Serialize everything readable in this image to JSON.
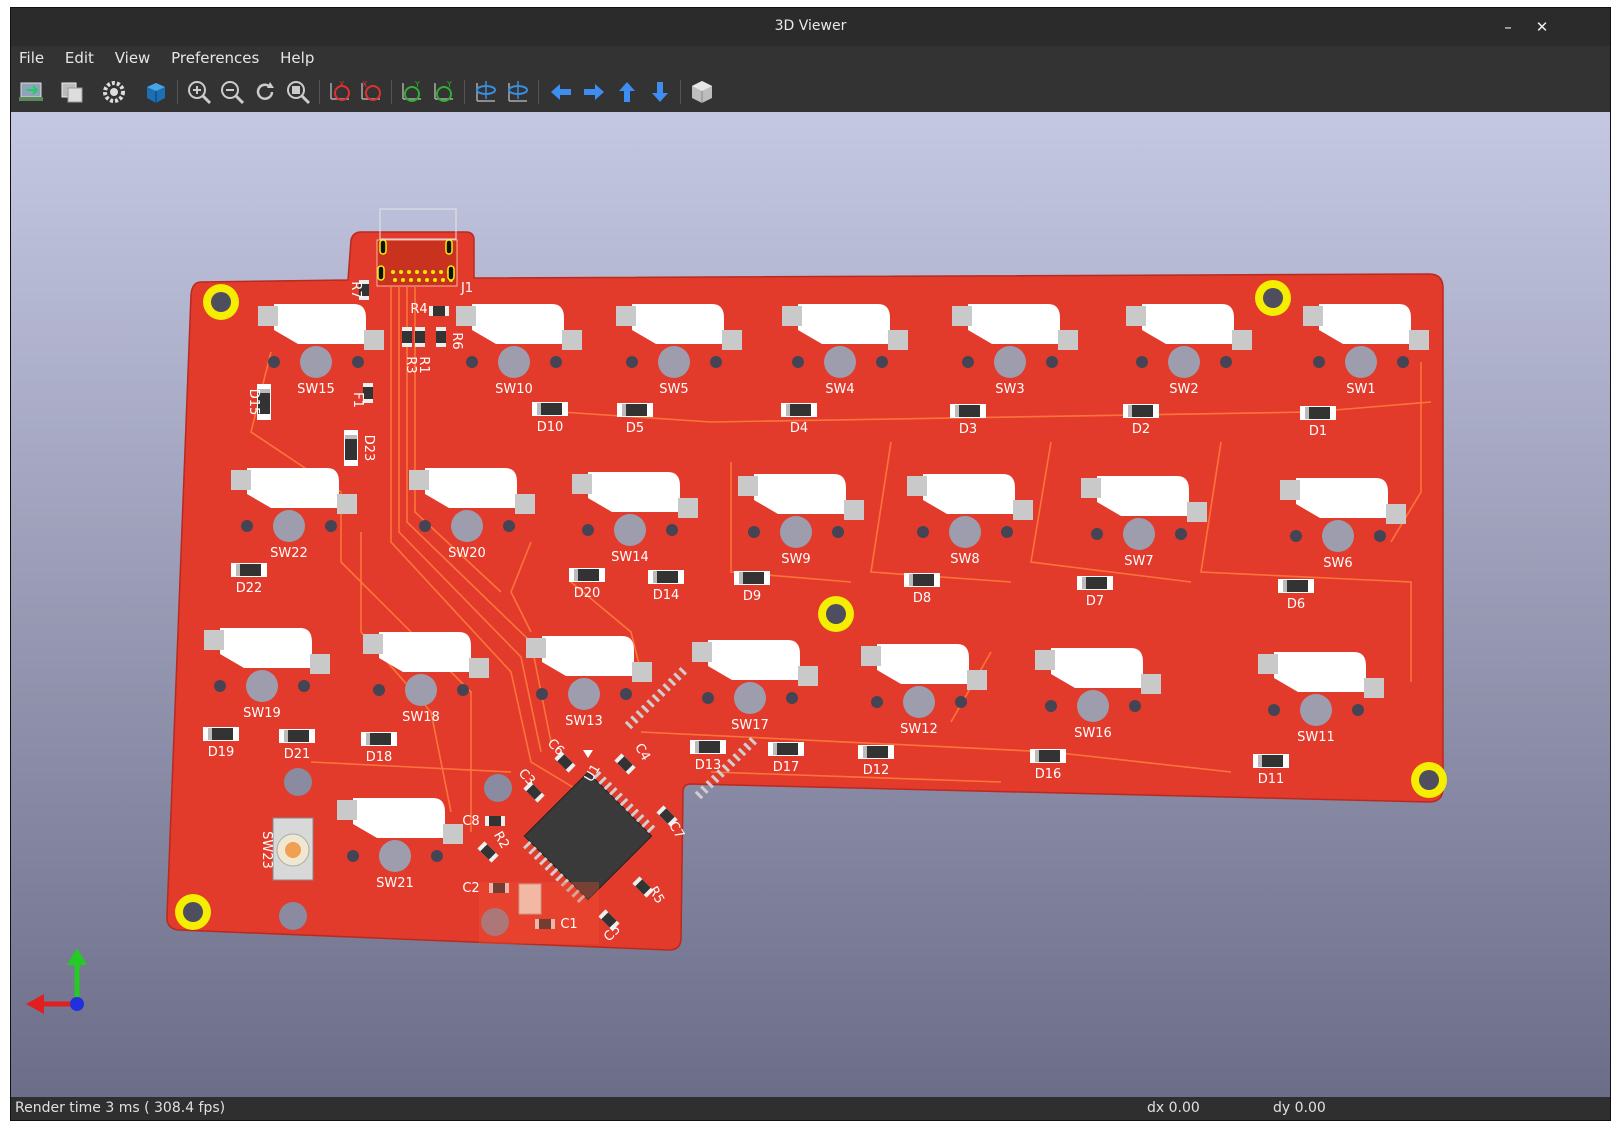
{
  "window": {
    "title": "3D Viewer",
    "minimize_glyph": "–",
    "close_glyph": "✕"
  },
  "menu": [
    "File",
    "Edit",
    "View",
    "Preferences",
    "Help"
  ],
  "toolbar": [
    {
      "icon": "reload-board-icon"
    },
    {
      "icon": "copy-image-icon"
    },
    {
      "icon": "settings-gear-icon"
    },
    {
      "icon": "raytracing-cube-icon"
    },
    {
      "icon": "zoom-in-icon"
    },
    {
      "icon": "zoom-out-icon"
    },
    {
      "icon": "redraw-icon"
    },
    {
      "icon": "zoom-fit-icon"
    },
    {
      "icon": "rotate-x-cw-icon"
    },
    {
      "icon": "rotate-x-ccw-icon"
    },
    {
      "icon": "rotate-y-cw-icon"
    },
    {
      "icon": "rotate-y-ccw-icon"
    },
    {
      "icon": "rotate-z-cw-icon"
    },
    {
      "icon": "rotate-z-ccw-icon"
    },
    {
      "icon": "pan-left-icon"
    },
    {
      "icon": "pan-right-icon"
    },
    {
      "icon": "pan-up-icon"
    },
    {
      "icon": "pan-down-icon"
    },
    {
      "icon": "orthographic-toggle-icon"
    }
  ],
  "status": {
    "render": "Render time 3 ms ( 308.4 fps)",
    "dx": "dx 0.00",
    "dy": "dy 0.00"
  },
  "colors": {
    "background_top": "#c5c8e2",
    "background_bottom": "#6c6d88",
    "board": "#e23b2c",
    "trace": "#ff7b3c",
    "mounting_hole": "#f5ee00",
    "keycap": "#ffffff",
    "pad": "#c9c9c9"
  },
  "board": {
    "connector": "J1",
    "resistors": [
      "R7",
      "R4",
      "R1",
      "R3",
      "R6",
      "R2",
      "R5"
    ],
    "fuse": "F1",
    "capacitors": [
      "C6",
      "C3",
      "C4",
      "C8",
      "C7",
      "C2",
      "C1",
      "C5"
    ],
    "ic": "U1",
    "switches": [
      {
        "label": "SW15",
        "row": 0
      },
      {
        "label": "SW10",
        "row": 0
      },
      {
        "label": "SW5",
        "row": 0
      },
      {
        "label": "SW4",
        "row": 0
      },
      {
        "label": "SW3",
        "row": 0
      },
      {
        "label": "SW2",
        "row": 0
      },
      {
        "label": "SW1",
        "row": 0
      },
      {
        "label": "SW22",
        "row": 1
      },
      {
        "label": "SW20",
        "row": 1
      },
      {
        "label": "SW14",
        "row": 1
      },
      {
        "label": "SW9",
        "row": 1
      },
      {
        "label": "SW8",
        "row": 1
      },
      {
        "label": "SW7",
        "row": 1
      },
      {
        "label": "SW6",
        "row": 1
      },
      {
        "label": "SW19",
        "row": 2
      },
      {
        "label": "SW18",
        "row": 2
      },
      {
        "label": "SW13",
        "row": 2
      },
      {
        "label": "SW17",
        "row": 2
      },
      {
        "label": "SW12",
        "row": 2
      },
      {
        "label": "SW16",
        "row": 2
      },
      {
        "label": "SW11",
        "row": 2
      },
      {
        "label": "SW21",
        "row": 3
      },
      {
        "label": "SW23",
        "row": 3
      }
    ],
    "diodes": [
      "D15",
      "D23",
      "D10",
      "D5",
      "D4",
      "D3",
      "D2",
      "D1",
      "D22",
      "D20",
      "D14",
      "D9",
      "D8",
      "D7",
      "D6",
      "D19",
      "D21",
      "D18",
      "D13",
      "D17",
      "D12",
      "D16",
      "D11"
    ]
  }
}
